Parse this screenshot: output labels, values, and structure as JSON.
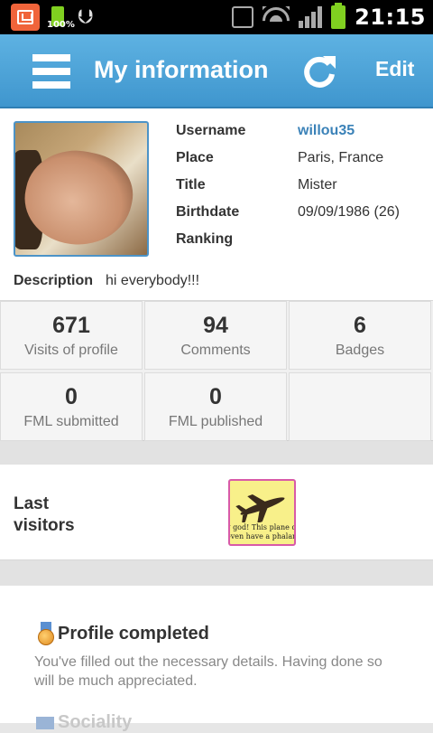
{
  "status_bar": {
    "battery_small_pct": "100%",
    "time": "21:15"
  },
  "action_bar": {
    "title": "My information",
    "edit_label": "Edit"
  },
  "profile": {
    "fields": [
      {
        "key": "Username",
        "value": "willou35"
      },
      {
        "key": "Place",
        "value": "Paris, France"
      },
      {
        "key": "Title",
        "value": "Mister"
      },
      {
        "key": "Birthdate",
        "value": "09/09/1986 (26)"
      },
      {
        "key": "Ranking",
        "value": ""
      }
    ],
    "description_label": "Description",
    "description_value": "hi everybody!!!"
  },
  "stats": [
    {
      "value": "671",
      "label": "Visits of profile"
    },
    {
      "value": "94",
      "label": "Comments"
    },
    {
      "value": "6",
      "label": "Badges"
    },
    {
      "value": "0",
      "label": "FML submitted"
    },
    {
      "value": "0",
      "label": "FML published"
    }
  ],
  "visitors": {
    "label": "Last visitors",
    "thumb_caption_line1": "y god! This plane do",
    "thumb_caption_line2": "even have a phalange"
  },
  "achievements": {
    "title": "Profile completed",
    "description": "You've filled out the necessary details. Having done so will be much appreciated.",
    "next_title": "Sociality"
  },
  "colors": {
    "action_bar": "#4aa3d8",
    "link": "#3b82b8",
    "battery": "#80d020"
  }
}
